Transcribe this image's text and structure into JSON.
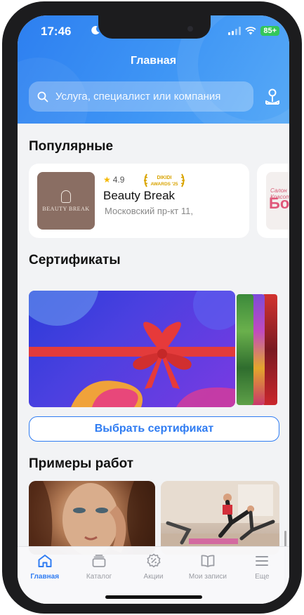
{
  "status": {
    "time": "17:46",
    "battery": "85+"
  },
  "header": {
    "title": "Главная",
    "search_placeholder": "Услуга, специалист или компания"
  },
  "popular": {
    "heading": "Популярные",
    "items": [
      {
        "rating": "4.9",
        "award_line1": "DIKIDI",
        "award_line2": "AWARDS '25",
        "thumb_label": "BEAUTY BREAK",
        "name": "Beauty Break",
        "address": "Московский пр-кт 11,"
      },
      {
        "thumb_line1": "Салон Красоты",
        "thumb_line2": "Бо"
      }
    ]
  },
  "certificates": {
    "heading": "Сертификаты",
    "button": "Выбрать сертификат"
  },
  "works": {
    "heading": "Примеры работ"
  },
  "tabs": [
    {
      "label": "Главная",
      "icon": "home-icon",
      "active": true
    },
    {
      "label": "Каталог",
      "icon": "catalog-icon",
      "active": false
    },
    {
      "label": "Акции",
      "icon": "percent-badge-icon",
      "active": false
    },
    {
      "label": "Мои записи",
      "icon": "book-icon",
      "active": false
    },
    {
      "label": "Еще",
      "icon": "menu-icon",
      "active": false
    }
  ],
  "colors": {
    "accent": "#2f7cf2",
    "header": "#3f96f5",
    "star": "#f5b800",
    "award_gold": "#d9a400"
  }
}
